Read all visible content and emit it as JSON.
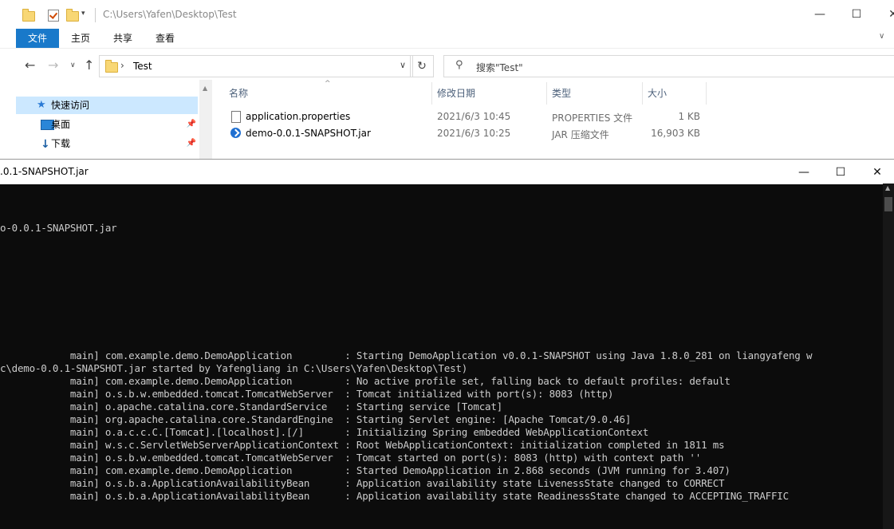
{
  "explorer": {
    "title_path": "C:\\Users\\Yafen\\Desktop\\Test",
    "ribbon_tabs": [
      "文件",
      "主页",
      "共享",
      "查看"
    ],
    "address_crumb": "Test",
    "search_placeholder": "搜索\"Test\"",
    "sidebar": [
      {
        "label": "快速访问",
        "icon": "star-icon"
      },
      {
        "label": "桌面",
        "icon": "desktop-icon"
      },
      {
        "label": "下载",
        "icon": "download-icon"
      }
    ],
    "columns": [
      "名称",
      "修改日期",
      "类型",
      "大小"
    ],
    "files": [
      {
        "name": "application.properties",
        "date": "2021/6/3 10:45",
        "type": "PROPERTIES 文件",
        "size": "1 KB",
        "icon": "document-icon"
      },
      {
        "name": "demo-0.0.1-SNAPSHOT.jar",
        "date": "2021/6/3 10:25",
        "type": "JAR 压缩文件",
        "size": "16,903 KB",
        "icon": "jar-icon"
      }
    ]
  },
  "console": {
    "title": ".0.1-SNAPSHOT.jar",
    "lines": [
      "o-0.0.1-SNAPSHOT.jar",
      "",
      "",
      "",
      "",
      "",
      "",
      "            main] com.example.demo.DemoApplication         : Starting DemoApplication v0.0.1-SNAPSHOT using Java 1.8.0_281 on liangyafeng w",
      "c\\demo-0.0.1-SNAPSHOT.jar started by Yafengliang in C:\\Users\\Yafen\\Desktop\\Test)",
      "            main] com.example.demo.DemoApplication         : No active profile set, falling back to default profiles: default",
      "            main] o.s.b.w.embedded.tomcat.TomcatWebServer  : Tomcat initialized with port(s): 8083 (http)",
      "            main] o.apache.catalina.core.StandardService   : Starting service [Tomcat]",
      "            main] org.apache.catalina.core.StandardEngine  : Starting Servlet engine: [Apache Tomcat/9.0.46]",
      "            main] o.a.c.c.C.[Tomcat].[localhost].[/]       : Initializing Spring embedded WebApplicationContext",
      "            main] w.s.c.ServletWebServerApplicationContext : Root WebApplicationContext: initialization completed in 1811 ms",
      "            main] o.s.b.w.embedded.tomcat.TomcatWebServer  : Tomcat started on port(s): 8083 (http) with context path ''",
      "            main] com.example.demo.DemoApplication         : Started DemoApplication in 2.868 seconds (JVM running for 3.407)",
      "            main] o.s.b.a.ApplicationAvailabilityBean      : Application availability state LivenessState changed to CORRECT",
      "            main] o.s.b.a.ApplicationAvailabilityBean      : Application availability state ReadinessState changed to ACCEPTING_TRAFFIC"
    ]
  }
}
